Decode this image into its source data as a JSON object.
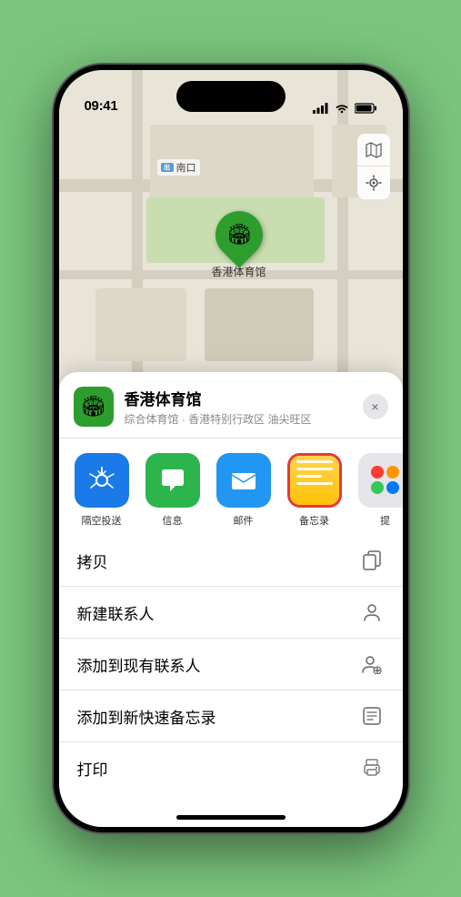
{
  "status_bar": {
    "time": "09:41",
    "location_icon": "▶",
    "signal_bars": "▐▐▐▐",
    "wifi": "WiFi",
    "battery": "🔋"
  },
  "map": {
    "label_text": "南口",
    "marker_label": "香港体育馆",
    "controls": {
      "map_icon": "🗺",
      "location_icon": "➤"
    }
  },
  "location_header": {
    "name": "香港体育馆",
    "subtitle": "综合体育馆 · 香港特别行政区 油尖旺区",
    "close_label": "×"
  },
  "share_items": [
    {
      "id": "airdrop",
      "label": "隔空投送",
      "type": "airdrop"
    },
    {
      "id": "message",
      "label": "信息",
      "type": "message"
    },
    {
      "id": "mail",
      "label": "邮件",
      "type": "mail"
    },
    {
      "id": "notes",
      "label": "备忘录",
      "type": "notes"
    },
    {
      "id": "more",
      "label": "提",
      "type": "more"
    }
  ],
  "menu_items": [
    {
      "id": "copy",
      "label": "拷贝",
      "icon": "copy"
    },
    {
      "id": "new-contact",
      "label": "新建联系人",
      "icon": "person"
    },
    {
      "id": "add-existing",
      "label": "添加到现有联系人",
      "icon": "person-add"
    },
    {
      "id": "add-notes",
      "label": "添加到新快速备忘录",
      "icon": "note"
    },
    {
      "id": "print",
      "label": "打印",
      "icon": "printer"
    }
  ]
}
